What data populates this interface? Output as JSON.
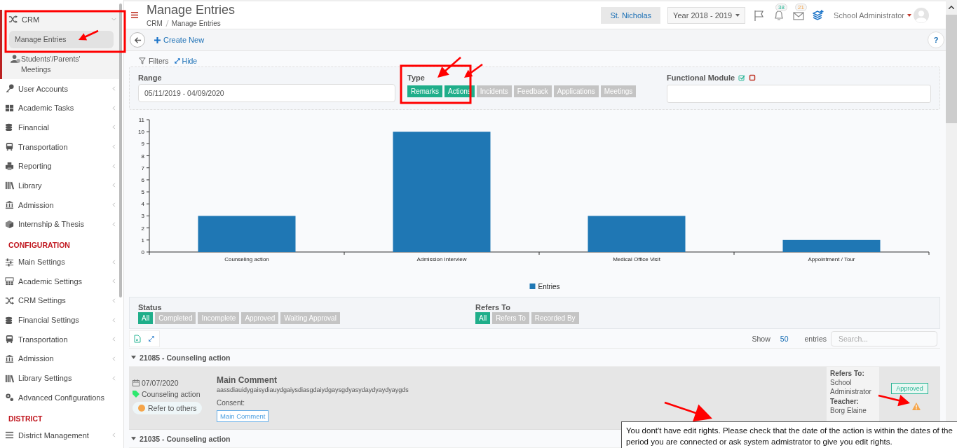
{
  "sidebar": {
    "sections": [
      {
        "items": [
          {
            "label": "CRM",
            "kind": "shuffle",
            "expandable": true,
            "expanded": true,
            "children": [
              {
                "label": "Manage Entries",
                "selected": true,
                "kind": "none"
              },
              {
                "label": "Students'/Parents' Meetings",
                "selected": false,
                "kind": "person"
              }
            ]
          },
          {
            "label": "User Accounts",
            "kind": "key",
            "expandable": true,
            "expanded": false
          },
          {
            "label": "Academic Tasks",
            "kind": "grid",
            "expandable": true,
            "expanded": false
          },
          {
            "label": "Financial",
            "kind": "coins",
            "expandable": true,
            "expanded": false
          },
          {
            "label": "Transportation",
            "kind": "bus",
            "expandable": true,
            "expanded": false
          },
          {
            "label": "Reporting",
            "kind": "printer",
            "expandable": true,
            "expanded": false
          },
          {
            "label": "Library",
            "kind": "books",
            "expandable": true,
            "expanded": false
          },
          {
            "label": "Admission",
            "kind": "bank",
            "expandable": true,
            "expanded": false
          },
          {
            "label": "Internship & Thesis",
            "kind": "cube",
            "expandable": true,
            "expanded": false
          }
        ]
      },
      {
        "header": "CONFIGURATION",
        "items": [
          {
            "label": "Main Settings",
            "kind": "sliders",
            "expandable": true,
            "expanded": false
          },
          {
            "label": "Academic Settings",
            "kind": "people",
            "expandable": true,
            "expanded": false
          },
          {
            "label": "CRM Settings",
            "kind": "shuffle",
            "expandable": true,
            "expanded": false
          },
          {
            "label": "Financial Settings",
            "kind": "coins",
            "expandable": true,
            "expanded": false
          },
          {
            "label": "Transportation",
            "kind": "bus",
            "expandable": true,
            "expanded": false
          },
          {
            "label": "Admission",
            "kind": "bank",
            "expandable": true,
            "expanded": false
          },
          {
            "label": "Library Settings",
            "kind": "books",
            "expandable": true,
            "expanded": false
          },
          {
            "label": "Advanced Configurations",
            "kind": "gears",
            "expandable": false,
            "expanded": false
          }
        ]
      },
      {
        "header": "DISTRICT",
        "items": [
          {
            "label": "District Management",
            "kind": "list",
            "expandable": true,
            "expanded": false
          }
        ]
      }
    ]
  },
  "header": {
    "title": "Manage Entries",
    "breadcrumb": [
      "CRM",
      "Manage Entries"
    ],
    "school": "St. Nicholas",
    "year": "Year 2018 - 2019",
    "notifications": [
      {
        "kind": "flag"
      },
      {
        "kind": "bell",
        "count": "38"
      },
      {
        "kind": "mail",
        "count": "21"
      },
      {
        "kind": "layers"
      }
    ],
    "user": "School Administrator"
  },
  "toolbar": {
    "create": "Create New",
    "help": "?"
  },
  "filters": {
    "label": "Filters",
    "hide": "Hide",
    "range_label": "Range",
    "range": "05/11/2019 - 04/09/2020",
    "type_label": "Type",
    "types": [
      {
        "label": "Remarks",
        "selected": true
      },
      {
        "label": "Actions",
        "selected": true
      },
      {
        "label": "Incidents",
        "selected": false
      },
      {
        "label": "Feedback",
        "selected": false
      },
      {
        "label": "Applications",
        "selected": false
      },
      {
        "label": "Meetings",
        "selected": false
      }
    ],
    "module_label": "Functional Module"
  },
  "chart_data": {
    "type": "bar",
    "categories": [
      "Counseling action",
      "Admission Interview",
      "Medical Office Visit",
      "Appointment / Tour"
    ],
    "series": [
      {
        "name": "Entries",
        "color": "#1f77b4",
        "values": [
          3,
          10,
          3,
          1
        ]
      }
    ],
    "ylim": [
      0,
      11
    ],
    "yticks": [
      0,
      1,
      2,
      3,
      4,
      5,
      6,
      7,
      8,
      9,
      10,
      11
    ]
  },
  "status": {
    "label": "Status",
    "chips": [
      {
        "label": "All",
        "selected": true
      },
      {
        "label": "Completed",
        "selected": false
      },
      {
        "label": "Incomplete",
        "selected": false
      },
      {
        "label": "Approved",
        "selected": false
      },
      {
        "label": "Waiting Approval",
        "selected": false
      }
    ],
    "refers_label": "Refers To",
    "refers": [
      {
        "label": "All",
        "selected": true
      },
      {
        "label": "Refers To",
        "selected": false
      },
      {
        "label": "Recorded By",
        "selected": false
      }
    ]
  },
  "table": {
    "show": "Show",
    "page_size": "50",
    "entries": "entries",
    "search_placeholder": "Search..."
  },
  "groups": [
    {
      "title": "21085 - Counseling action",
      "expanded": true,
      "entry": {
        "date": "07/07/2020",
        "type": "Counseling action",
        "state": "Refer to others",
        "comment_title": "Main Comment",
        "comment": "aassdiauidygaisydiauydgaiysdiasgdaiydgaysgdyasydaydyaydyaygds",
        "consent": "Consent:",
        "comment_button": "Main Comment",
        "refers_label": "Refers To:",
        "refers": "School Administrator",
        "teacher_label": "Teacher:",
        "teacher": "Borg Elaine",
        "badge": "Approved"
      }
    },
    {
      "title": "21035 - Counseling action",
      "expanded": true
    }
  ],
  "tooltip": "You dont't have edit rights. Please check that the date of the action is within the dates of the period you are connected or ask system admistrator to give you edit rights."
}
